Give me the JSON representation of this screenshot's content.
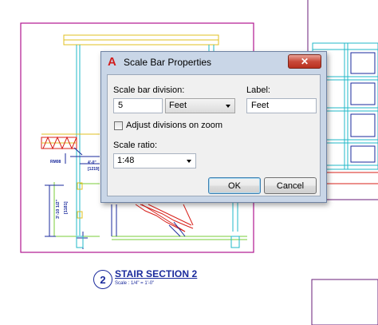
{
  "dialog": {
    "title": "Scale Bar Properties",
    "app_icon": "A",
    "close_glyph": "✕",
    "division_label": "Scale bar division:",
    "division_value": "5",
    "unit_value": "Feet",
    "label_label": "Label:",
    "label_value": "Feet",
    "adjust_label": "Adjust divisions on zoom",
    "adjust_checked": false,
    "ratio_label": "Scale ratio:",
    "ratio_value": "1:48",
    "ok_label": "OK",
    "cancel_label": "Cancel"
  },
  "drawing": {
    "section_number": "2",
    "section_title": "STAIR SECTION 2",
    "section_scale": "Scale : 1/4\" = 1'-0\"",
    "dim_1": "4'-0\"",
    "dim_2": "[1219]",
    "dim_3": "3'-10 1/2\"",
    "dim_4": "[1181]",
    "dim_5": "RM08",
    "colors": {
      "magenta": "#b0168f",
      "cyan": "#20b8c8",
      "green": "#7acc3a",
      "blue": "#1a2a9c",
      "red": "#d8201a",
      "yellow": "#e0c020"
    }
  }
}
